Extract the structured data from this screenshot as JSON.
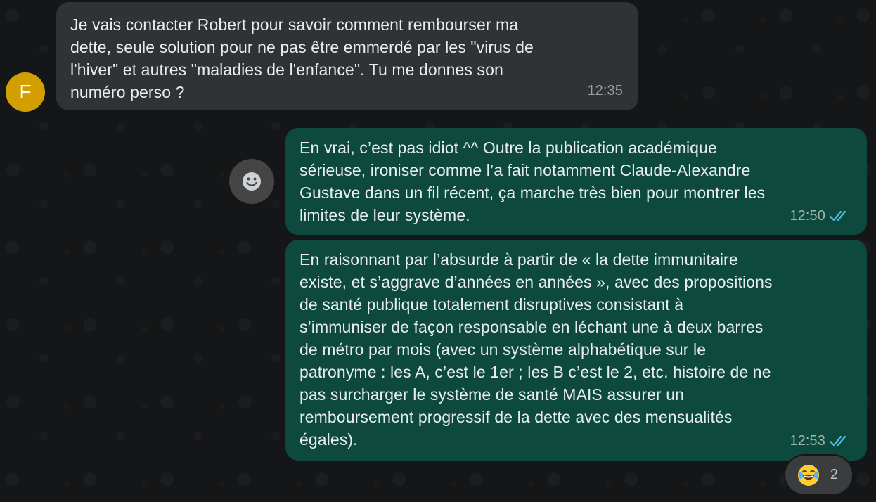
{
  "contact": {
    "avatar_initial": "F",
    "avatar_color": "#d39e00"
  },
  "messages": [
    {
      "direction": "incoming",
      "text": "Je vais contacter Robert pour savoir comment rembourser ma\ndette, seule solution pour ne pas être emmerdé par les \"virus de\nl'hiver\" et autres \"maladies de l'enfance\". Tu me donnes son\nnuméro perso ?",
      "time": "12:35"
    },
    {
      "direction": "outgoing",
      "text": "En vrai, c’est pas idiot ^^ Outre la publication académique\nsérieuse, ironiser comme l’a fait notamment Claude-Alexandre\nGustave dans un fil récent, ça marche très bien pour montrer les\nlimites de leur système.",
      "time": "12:50",
      "status": "read",
      "status_icon": "double-check-icon"
    },
    {
      "direction": "outgoing",
      "text": "En raisonnant par l’absurde à partir de « la dette immunitaire\nexiste, et s’aggrave d’années en années », avec des propositions\nde santé publique totalement disruptives consistant à\ns’immuniser de façon responsable en léchant une à deux barres\nde métro par mois (avec un système alphabétique sur le\npatronyme : les A, c’est le 1er ; les B c’est le 2, etc. histoire de ne\npas surcharger le système de santé MAIS assurer un\nremboursement progressif de la dette avec des mensualités\négales).",
      "time": "12:53",
      "status": "read",
      "status_icon": "double-check-icon"
    }
  ],
  "reaction": {
    "emoji": "😂",
    "count": "2"
  },
  "emoji_button_icon": "smiley-icon",
  "colors": {
    "background": "#151617",
    "incoming_bubble": "#303234",
    "outgoing_bubble": "#0d4a3d",
    "read_ticks": "#53bdeb"
  }
}
